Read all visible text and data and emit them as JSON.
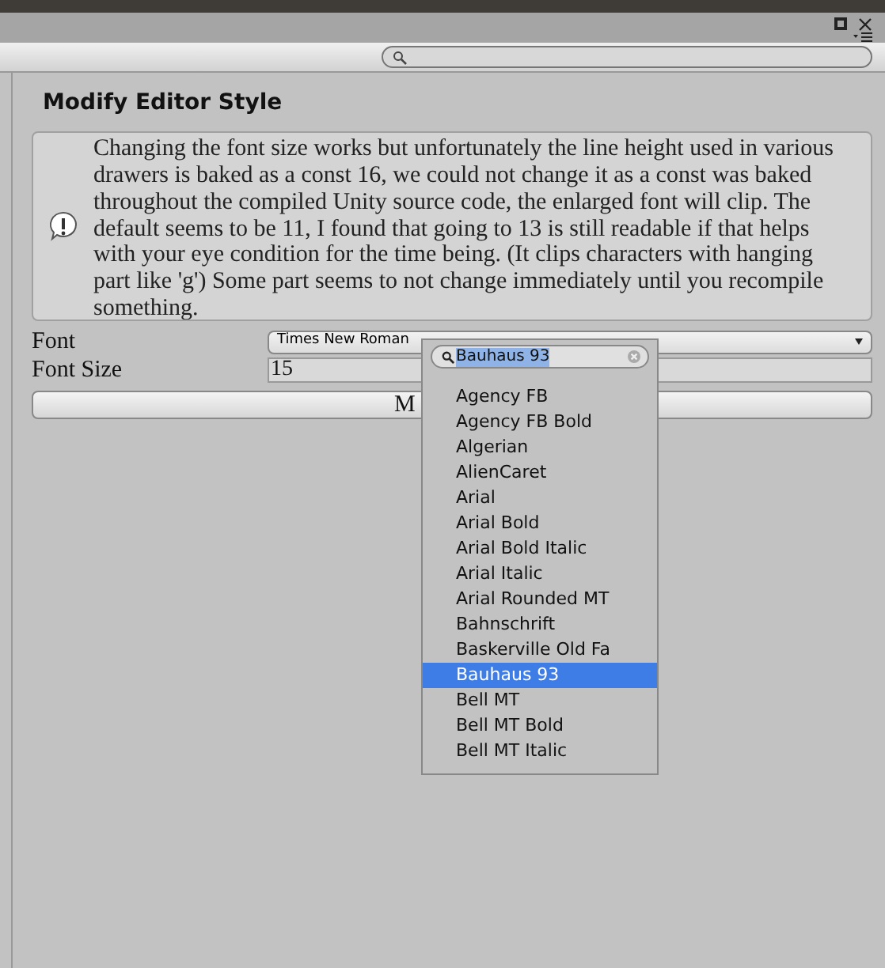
{
  "window": {
    "title": "Modify Editor Style"
  },
  "help_box": {
    "text": "Changing the font size works but unfortunately the line height used in various drawers is baked as a const 16, we could not change it as a const was baked throughout the compiled Unity source code, the enlarged font will clip. The default seems to be 11, I found that going to 13 is still readable if that helps with your eye condition for the time being. (It clips characters with hanging part like 'g') Some part seems to not change immediately until you recompile something."
  },
  "fields": [
    {
      "kind": "dropdown",
      "label": "Font",
      "value": "Times New Roman"
    },
    {
      "kind": "text",
      "label": "Font Size",
      "value": "15"
    }
  ],
  "button": {
    "label": "M"
  },
  "font_popup": {
    "search": {
      "value": "Bauhaus 93"
    },
    "items": [
      {
        "label": "Agency FB",
        "selected": false
      },
      {
        "label": "Agency FB Bold",
        "selected": false
      },
      {
        "label": "Algerian",
        "selected": false
      },
      {
        "label": "AlienCaret",
        "selected": false
      },
      {
        "label": "Arial",
        "selected": false
      },
      {
        "label": "Arial Bold",
        "selected": false
      },
      {
        "label": "Arial Bold Italic",
        "selected": false
      },
      {
        "label": "Arial Italic",
        "selected": false
      },
      {
        "label": "Arial Rounded MT",
        "selected": false
      },
      {
        "label": "Bahnschrift",
        "selected": false
      },
      {
        "label": "Baskerville Old Fa",
        "selected": false
      },
      {
        "label": "Bauhaus 93",
        "selected": true
      },
      {
        "label": "Bell MT",
        "selected": false
      },
      {
        "label": "Bell MT Bold",
        "selected": false
      },
      {
        "label": "Bell MT Italic",
        "selected": false
      }
    ]
  }
}
